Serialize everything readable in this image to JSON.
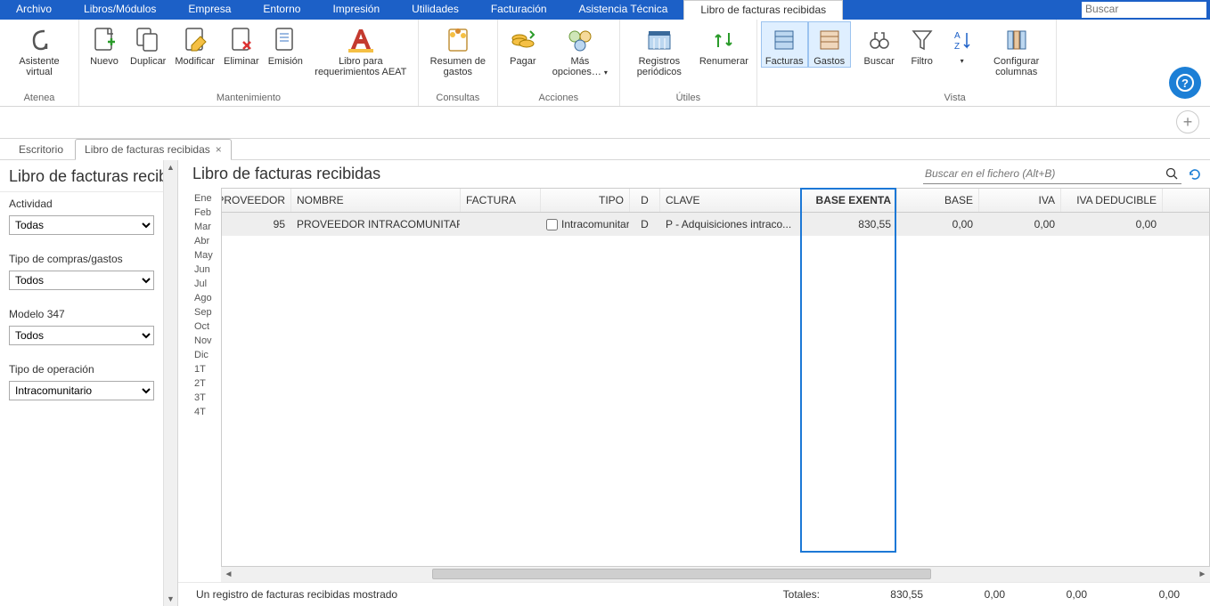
{
  "menu": {
    "items": [
      "Archivo",
      "Libros/Módulos",
      "Empresa",
      "Entorno",
      "Impresión",
      "Utilidades",
      "Facturación",
      "Asistencia Técnica",
      "Libro de facturas recibidas"
    ],
    "active_index": 8,
    "search_placeholder": "Buscar"
  },
  "ribbon": {
    "groups": [
      {
        "label": "Atenea",
        "buttons": [
          {
            "name": "asistente",
            "label": "Asistente virtual"
          }
        ]
      },
      {
        "label": "Mantenimiento",
        "buttons": [
          {
            "name": "nuevo",
            "label": "Nuevo"
          },
          {
            "name": "duplicar",
            "label": "Duplicar"
          },
          {
            "name": "modificar",
            "label": "Modificar"
          },
          {
            "name": "eliminar",
            "label": "Eliminar"
          },
          {
            "name": "emision",
            "label": "Emisión"
          },
          {
            "name": "libro-req",
            "label": "Libro para requerimientos AEAT",
            "wide": true
          }
        ]
      },
      {
        "label": "Consultas",
        "buttons": [
          {
            "name": "resumen",
            "label": "Resumen de gastos"
          }
        ]
      },
      {
        "label": "Acciones",
        "buttons": [
          {
            "name": "pagar",
            "label": "Pagar"
          },
          {
            "name": "mas-opciones",
            "label": "Más opciones…",
            "split": true
          }
        ]
      },
      {
        "label": "Útiles",
        "buttons": [
          {
            "name": "registros",
            "label": "Registros periódicos"
          },
          {
            "name": "renumerar",
            "label": "Renumerar"
          }
        ]
      },
      {
        "label": "",
        "buttons": [
          {
            "name": "facturas",
            "label": "Facturas",
            "active": true
          },
          {
            "name": "gastos",
            "label": "Gastos",
            "active": true
          }
        ]
      },
      {
        "label": "Vista",
        "buttons": [
          {
            "name": "buscar",
            "label": "Buscar"
          },
          {
            "name": "filtro",
            "label": "Filtro"
          },
          {
            "name": "ordenar",
            "label": ""
          },
          {
            "name": "config-col",
            "label": "Configurar columnas"
          }
        ]
      }
    ]
  },
  "tabs": {
    "items": [
      {
        "label": "Escritorio",
        "closable": false
      },
      {
        "label": "Libro de facturas recibidas",
        "closable": true
      }
    ],
    "active_index": 1
  },
  "left": {
    "title": "Libro de facturas recibidas",
    "fields": [
      {
        "label": "Actividad",
        "value": "Todas"
      },
      {
        "label": "Tipo de compras/gastos",
        "value": "Todos"
      },
      {
        "label": "Modelo 347",
        "value": "Todos"
      },
      {
        "label": "Tipo de operación",
        "value": "Intracomunitario"
      }
    ]
  },
  "content": {
    "title": "Libro de facturas recibidas",
    "search_placeholder": "Buscar en el fichero (Alt+B)",
    "months": [
      "Ene",
      "Feb",
      "Mar",
      "Abr",
      "May",
      "Jun",
      "Jul",
      "Ago",
      "Sep",
      "Oct",
      "Nov",
      "Dic",
      "1T",
      "2T",
      "3T",
      "4T"
    ],
    "columns": [
      "PROVEEDOR",
      "NOMBRE",
      "FACTURA",
      "TIPO",
      "D",
      "CLAVE",
      "BASE EXENTA",
      "BASE",
      "IVA",
      "IVA DEDUCIBLE"
    ],
    "selected_col": "BASE EXENTA",
    "rows": [
      {
        "proveedor": "95",
        "nombre": "PROVEEDOR INTRACOMUNITARIO",
        "factura": "",
        "tipo": "Intracomunitar...",
        "d": "D",
        "clave": "P - Adquisiciones intraco...",
        "base_exenta": "830,55",
        "base": "0,00",
        "iva": "0,00",
        "iva_deducible": "0,00",
        "check": false
      }
    ],
    "status": "Un registro de facturas recibidas mostrado",
    "totals_label": "Totales:",
    "totals": {
      "base_exenta": "830,55",
      "base": "0,00",
      "iva": "0,00",
      "iva_deducible": "0,00"
    }
  }
}
